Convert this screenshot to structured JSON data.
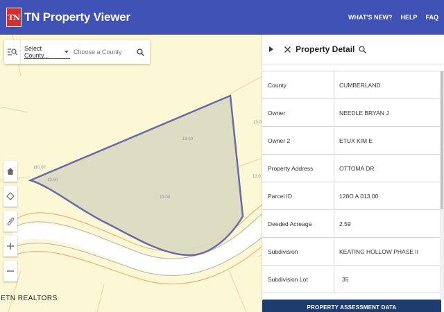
{
  "header": {
    "logo_text": "TN",
    "app_title": "TN Property Viewer",
    "nav": [
      {
        "label": "WHAT'S NEW?"
      },
      {
        "label": "HELP"
      },
      {
        "label": "FAQ"
      }
    ],
    "bar_color": "#3f51b5"
  },
  "search": {
    "county_select_label": "Select County...",
    "county_input_placeholder": "Choose a County"
  },
  "map": {
    "parcel_labels": [
      "13.00",
      "13.00",
      "13.00",
      "110.02",
      "13.0",
      "12.0"
    ],
    "scale_text": "ETN REALTORS"
  },
  "panel": {
    "title": "Property Detail",
    "rows": [
      {
        "label": "County",
        "value": "CUMBERLAND"
      },
      {
        "label": "Owner",
        "value": "NEEDLE BRYAN J"
      },
      {
        "label": "Owner 2",
        "value": "ETUX KIM E"
      },
      {
        "label": "Property Address",
        "value": "OTTOMA DR"
      },
      {
        "label": "Parcel ID",
        "value": "128O A 013.00"
      },
      {
        "label": "Deeded Acreage",
        "value": "2.59"
      },
      {
        "label": "Subdivision",
        "value": "KEATING HOLLOW PHASE II"
      },
      {
        "label": "Subdivision Lot",
        "value": "35"
      }
    ],
    "assessment_button": "PROPERTY ASSESSMENT DATA"
  }
}
